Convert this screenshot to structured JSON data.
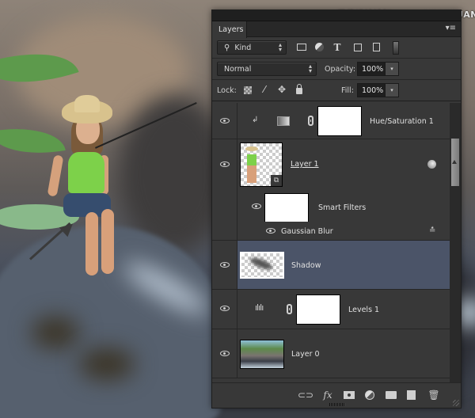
{
  "watermark": "思缘设计论坛 www.MISSYUAN.COM",
  "panel": {
    "tab_label": "Layers",
    "menu_icon": "panel-menu-icon",
    "filter": {
      "kind_label": "Kind",
      "icons": [
        "pixel-layer-filter-icon",
        "adjustment-layer-filter-icon",
        "type-layer-filter-icon",
        "shape-layer-filter-icon",
        "smart-object-filter-icon",
        "filter-toggle-switch"
      ]
    },
    "blend_mode": "Normal",
    "opacity_label": "Opacity:",
    "opacity_value": "100%",
    "lock_label": "Lock:",
    "lock_icons": [
      "lock-transparent-pixels-icon",
      "lock-image-pixels-icon",
      "lock-position-icon",
      "lock-all-icon"
    ],
    "fill_label": "Fill:",
    "fill_value": "100%"
  },
  "layers": [
    {
      "name": "Hue/Saturation 1",
      "type": "adjustment",
      "visible": true,
      "clipped": true,
      "adjustment_icon": "hue-saturation-icon",
      "selected": false
    },
    {
      "name": "Layer 1",
      "type": "smart-object",
      "visible": true,
      "selected": false,
      "has_smart_filters": true
    },
    {
      "name": "Smart Filters",
      "type": "smart-filters",
      "visible": true,
      "selected": false
    },
    {
      "name": "Gaussian Blur",
      "type": "filter-effect",
      "visible": true,
      "selected": false
    },
    {
      "name": "Shadow",
      "type": "pixel",
      "visible": true,
      "selected": true
    },
    {
      "name": "Levels 1",
      "type": "adjustment",
      "visible": true,
      "adjustment_icon": "levels-icon",
      "selected": false
    },
    {
      "name": "Layer 0",
      "type": "pixel",
      "visible": true,
      "selected": false
    }
  ],
  "footer": {
    "icons": [
      "link-layers-icon",
      "fx-icon",
      "add-mask-icon",
      "new-adjustment-icon",
      "new-group-icon",
      "new-layer-icon",
      "delete-layer-icon"
    ],
    "fx_label": "fx"
  },
  "colors": {
    "panel_bg": "#383838",
    "selected_row": "#4b5468",
    "text": "#e0e0e0"
  }
}
